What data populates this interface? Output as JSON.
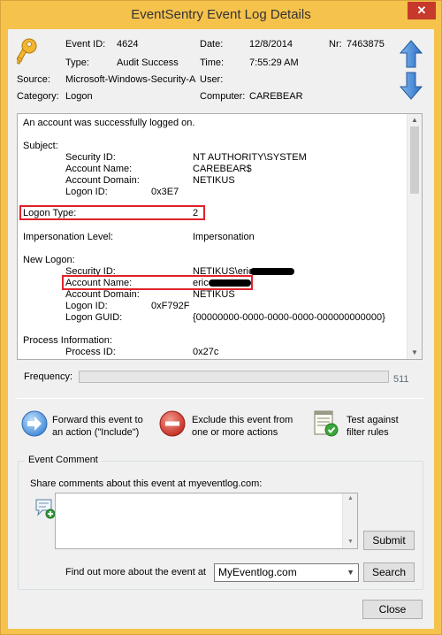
{
  "window": {
    "title": "EventSentry Event Log Details",
    "close_glyph": "✕"
  },
  "header": {
    "event_id_label": "Event ID:",
    "event_id": "4624",
    "date_label": "Date:",
    "date": "12/8/2014",
    "nr_label": "Nr:",
    "nr": "7463875",
    "type_label": "Type:",
    "type": "Audit Success",
    "time_label": "Time:",
    "time": "7:55:29 AM",
    "source_label": "Source:",
    "source": "Microsoft-Windows-Security-A",
    "user_label": "User:",
    "user": "",
    "category_label": "Category:",
    "category": "Logon",
    "computer_label": "Computer:",
    "computer": "CAREBEAR",
    "icons": {
      "event": "key-icon",
      "prev": "arrow-up-icon",
      "next": "arrow-down-icon"
    }
  },
  "details": {
    "intro": "An account was successfully logged on.",
    "subject_header": "Subject:",
    "subject": [
      {
        "label": "Security ID:",
        "value": "NT AUTHORITY\\SYSTEM"
      },
      {
        "label": "Account Name:",
        "value": "CAREBEAR$"
      },
      {
        "label": "Account Domain:",
        "value": "NETIKUS"
      },
      {
        "label": "Logon ID:",
        "value": "0x3E7"
      }
    ],
    "logon_type_label": "Logon Type:",
    "logon_type": "2",
    "impersonation_label": "Impersonation Level:",
    "impersonation": "Impersonation",
    "new_logon_header": "New Logon:",
    "new_logon": [
      {
        "label": "Security ID:",
        "value": "NETIKUS\\eric"
      },
      {
        "label": "Account Name:",
        "value": "eric"
      },
      {
        "label": "Account Domain:",
        "value": "NETIKUS"
      },
      {
        "label": "Logon ID:",
        "value": "0xF792F"
      },
      {
        "label": "Logon GUID:",
        "value": "{00000000-0000-0000-0000-000000000000}"
      }
    ],
    "process_header": "Process Information:",
    "process": [
      {
        "label": "Process ID:",
        "value": "0x27c"
      }
    ]
  },
  "frequency": {
    "label": "Frequency:",
    "count": "511"
  },
  "actions": [
    {
      "icon": "forward-arrow-icon",
      "line1": "Forward this event to",
      "line2": "an action (\"Include\")"
    },
    {
      "icon": "exclude-icon",
      "line1": "Exclude this event from",
      "line2": "one or more actions"
    },
    {
      "icon": "test-filter-icon",
      "line1": "Test against",
      "line2": "filter rules"
    }
  ],
  "comment": {
    "group_title": "Event Comment",
    "prompt": "Share comments about this event at myeventlog.com:",
    "value": "",
    "submit_label": "Submit",
    "find_label": "Find out more about the event at",
    "site_selected": "MyEventlog.com",
    "search_label": "Search"
  },
  "footer": {
    "close_label": "Close"
  },
  "colors": {
    "frame": "#f5c24c",
    "highlight": "#e0222b",
    "accent_blue": "#2b78d6"
  }
}
